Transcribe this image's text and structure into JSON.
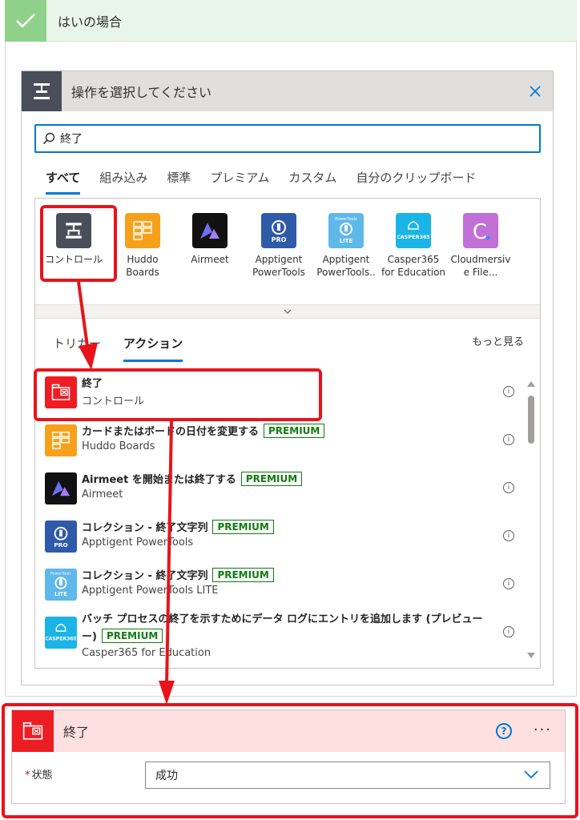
{
  "branch": {
    "title": "はいの場合"
  },
  "op_panel": {
    "title": "操作を選択してください",
    "search": {
      "value": "終了",
      "placeholder": ""
    },
    "tabs": [
      {
        "label": "すべて",
        "active": true
      },
      {
        "label": "組み込み"
      },
      {
        "label": "標準"
      },
      {
        "label": "プレミアム"
      },
      {
        "label": "カスタム"
      },
      {
        "label": "自分のクリップボード"
      }
    ],
    "connectors": [
      {
        "label_line1": "コントロール",
        "label_line2": "",
        "color": "#484f58",
        "icon": "control-icon"
      },
      {
        "label_line1": "Huddo",
        "label_line2": "Boards",
        "color": "#f7a11a",
        "icon": "huddo-boards-icon"
      },
      {
        "label_line1": "Airmeet",
        "label_line2": "",
        "color": "#111111",
        "icon": "airmeet-icon"
      },
      {
        "label_line1": "Apptigent",
        "label_line2": "PowerTools",
        "color": "#2f5aa8",
        "icon": "apptigent-pro-icon",
        "badge": "PRO"
      },
      {
        "label_line1": "Apptigent",
        "label_line2": "PowerTools..",
        "color": "#5fb8ea",
        "icon": "apptigent-lite-icon",
        "badge": "LITE",
        "top_text": "PowerTools"
      },
      {
        "label_line1": "Casper365",
        "label_line2": "for Education",
        "color": "#1bb4e6",
        "icon": "casper365-icon",
        "badge": "CASPER365"
      },
      {
        "label_line1": "Cloudmersiv",
        "label_line2": "e File...",
        "color": "#c36fd8",
        "icon": "cloudmersive-icon",
        "badge": "C"
      }
    ],
    "subtabs": [
      {
        "label": "トリガー"
      },
      {
        "label": "アクション",
        "active": true
      }
    ],
    "see_more": "もっと見る",
    "actions": [
      {
        "name": "終了",
        "sub": "コントロール",
        "premium": "",
        "color": "#ee1c23",
        "icon": "terminate-icon"
      },
      {
        "name": "カードまたはボードの日付を変更する",
        "sub": "Huddo Boards",
        "premium": "PREMIUM",
        "color": "#f7a11a",
        "icon": "huddo-boards-icon"
      },
      {
        "name": "Airmeet を開始または終了する",
        "sub": "Airmeet",
        "premium": "PREMIUM",
        "color": "#111111",
        "icon": "airmeet-icon"
      },
      {
        "name": "コレクション - 終了文字列",
        "sub": "Apptigent PowerTools",
        "premium": "PREMIUM",
        "color": "#2f5aa8",
        "icon": "apptigent-pro-icon"
      },
      {
        "name": "コレクション - 終了文字列",
        "sub": "Apptigent PowerTools LITE",
        "premium": "PREMIUM",
        "color": "#5fb8ea",
        "icon": "apptigent-lite-icon"
      },
      {
        "name": "バッチ プロセスの終了を示すためにデータ ログにエントリを追加します (プレビュー",
        "name2": "ー)",
        "sub": "Casper365 for Education",
        "premium": "PREMIUM",
        "color": "#1bb4e6",
        "icon": "casper365-icon"
      }
    ],
    "info_glyph": "i"
  },
  "terminate_card": {
    "title": "終了",
    "help_glyph": "?",
    "more_glyph": "···",
    "status_label": "状態",
    "required_mark": "*",
    "status_value": "成功",
    "color": "#ee1c23"
  },
  "annotation_color": "#e8131b"
}
